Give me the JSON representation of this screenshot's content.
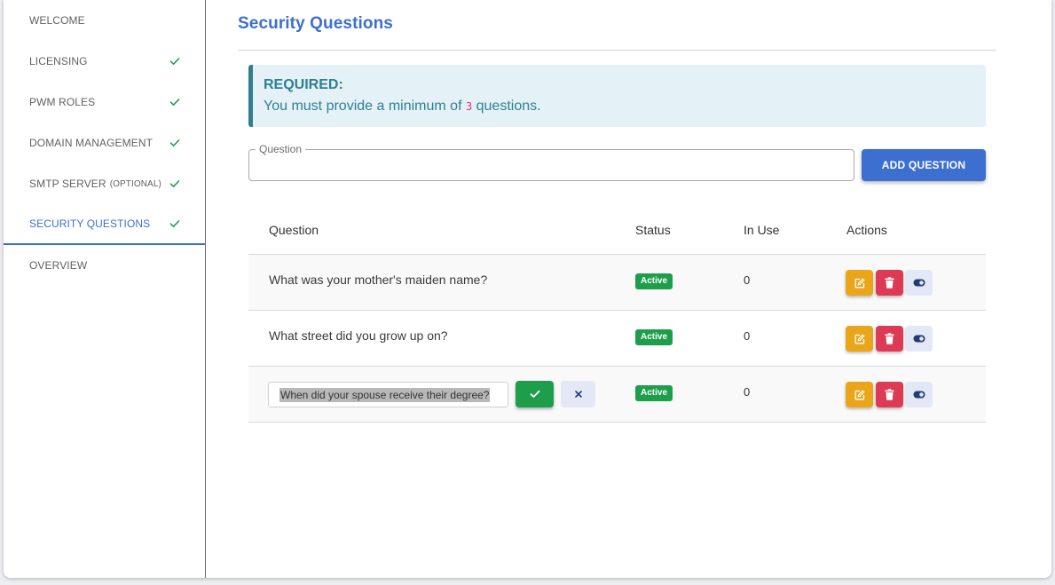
{
  "sidebar": {
    "items": [
      {
        "label": "WELCOME",
        "suffix": "",
        "completed": false,
        "active": false
      },
      {
        "label": "LICENSING",
        "suffix": "",
        "completed": true,
        "active": false
      },
      {
        "label": "PWM ROLES",
        "suffix": "",
        "completed": true,
        "active": false
      },
      {
        "label": "DOMAIN MANAGEMENT",
        "suffix": "",
        "completed": true,
        "active": false
      },
      {
        "label": "SMTP SERVER",
        "suffix": "(OPTIONAL)",
        "completed": true,
        "active": false
      },
      {
        "label": "SECURITY QUESTIONS",
        "suffix": "",
        "completed": true,
        "active": true
      },
      {
        "label": "OVERVIEW",
        "suffix": "",
        "completed": false,
        "active": false
      }
    ]
  },
  "page": {
    "title": "Security Questions"
  },
  "alert": {
    "title": "REQUIRED:",
    "message_prefix": "You must provide a minimum of ",
    "minimum": "3",
    "message_suffix": " questions."
  },
  "question_input": {
    "label": "Question",
    "value": ""
  },
  "add_button": {
    "label": "ADD QUESTION"
  },
  "table": {
    "columns": [
      "Question",
      "Status",
      "In Use",
      "Actions"
    ],
    "rows": [
      {
        "question": "What was your mother's maiden name?",
        "status": "Active",
        "in_use": "0",
        "editing": false
      },
      {
        "question": "What street did you grow up on?",
        "status": "Active",
        "in_use": "0",
        "editing": false
      },
      {
        "question": "When did your spouse receive their degree?",
        "status": "Active",
        "in_use": "0",
        "editing": true
      }
    ]
  },
  "colors": {
    "primary": "#3c6fcf",
    "success": "#1e9e4b",
    "warning": "#e9a61b",
    "danger": "#dd3b55",
    "info": "#2f7f92"
  },
  "icons": {
    "completed": "check-icon",
    "edit": "edit-icon",
    "delete": "trash-icon",
    "toggle": "toggle-icon",
    "confirm": "check-icon",
    "cancel": "close-icon"
  }
}
